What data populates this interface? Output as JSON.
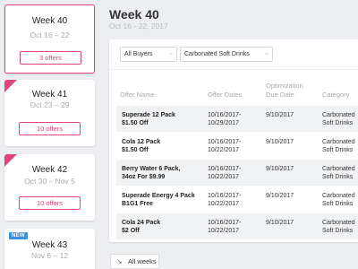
{
  "weeks": [
    {
      "title": "Week 40",
      "dates": "Oct 16 – 22",
      "offers": "3 offers",
      "selected": true
    },
    {
      "title": "Week 41",
      "dates": "Oct 23 – 29",
      "offers": "10 offers"
    },
    {
      "title": "Week 42",
      "dates": "Oct 30 – Nov 5",
      "offers": "10 offers"
    },
    {
      "title": "Week 43",
      "dates": "Nov 6 – 12",
      "badge": "NEW"
    }
  ],
  "main": {
    "title": "Week 40",
    "dates": "Oct 16 - 22, 2017"
  },
  "filters": {
    "buyers": "All Buyers",
    "category": "Carbonated Soft Drinks"
  },
  "table": {
    "headers": {
      "offer_name": "Offer Name",
      "offer_dates": "Offer Dates",
      "opt_due_line1": "Optimization",
      "opt_due_line2": "Due Date",
      "category": "Category"
    },
    "rows": [
      {
        "name1": "Superade 12 Pack",
        "name2": "$1.50 Off",
        "dates1": "10/16/2017-",
        "dates2": "10/29/2017",
        "due": "9/10/2017",
        "cat1": "Carbonated",
        "cat2": "Soft Drinks"
      },
      {
        "name1": "Cola 12 Pack",
        "name2": "$1.50 Off",
        "dates1": "10/16/2017-",
        "dates2": "10/22/2017",
        "due": "9/10/2017",
        "cat1": "Carbonated",
        "cat2": "Soft Drinks"
      },
      {
        "name1": "Berry Water 6 Pack,",
        "name2": "34oz For $9.99",
        "dates1": "10/16/2017-",
        "dates2": "10/22/2017",
        "due": "9/10/2017",
        "cat1": "Carbonated",
        "cat2": "Soft Drinks"
      },
      {
        "name1": "Superade Energy 4 Pack",
        "name2": "B1G1 Free",
        "dates1": "10/16/2017-",
        "dates2": "10/22/2017",
        "due": "9/10/2017",
        "cat1": "Carbonated",
        "cat2": "Soft Drinks"
      },
      {
        "name1": "Cola 24 Pack",
        "name2": "$2 Off",
        "dates1": "10/16/2017-",
        "dates2": "10/22/2017",
        "due": "9/10/2017",
        "cat1": "Carbonated",
        "cat2": "Soft Drinks"
      }
    ]
  },
  "footer": {
    "all_weeks": "All weeks"
  },
  "icons": {
    "chevron": "chevron-down-icon",
    "collapse": "collapse-arrows-icon"
  },
  "colors": {
    "accent": "#e0457b",
    "new_badge": "#3a8fe0",
    "background": "#eceef1"
  }
}
